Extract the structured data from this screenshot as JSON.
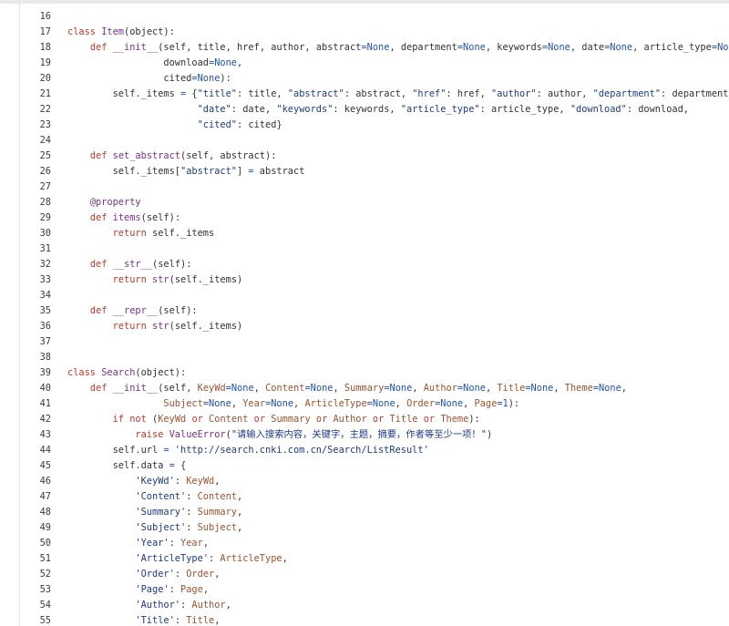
{
  "colors": {
    "keyword": "#c0392b",
    "function_name": "#7a2e8c",
    "constant": "#1f53b3",
    "string": "#1e3a8a",
    "argument": "#a0522d",
    "text": "#333333",
    "line_number": "#3a3a3a",
    "background": "#ffffff"
  },
  "code_lines": [
    {
      "num": "16",
      "tokens": []
    },
    {
      "num": "17",
      "tokens": [
        [
          "kw",
          "class"
        ],
        [
          "n",
          " "
        ],
        [
          "cls",
          "Item"
        ],
        [
          "n",
          "(object):"
        ]
      ]
    },
    {
      "num": "18",
      "tokens": [
        [
          "n",
          "    "
        ],
        [
          "kw",
          "def"
        ],
        [
          "n",
          " "
        ],
        [
          "fn",
          "__init__"
        ],
        [
          "n",
          "(self, title, href, author, abstract"
        ],
        [
          "op",
          "="
        ],
        [
          "con",
          "None"
        ],
        [
          "n",
          ", department"
        ],
        [
          "op",
          "="
        ],
        [
          "con",
          "None"
        ],
        [
          "n",
          ", keywords"
        ],
        [
          "op",
          "="
        ],
        [
          "con",
          "None"
        ],
        [
          "n",
          ", date"
        ],
        [
          "op",
          "="
        ],
        [
          "con",
          "None"
        ],
        [
          "n",
          ", article_type"
        ],
        [
          "op",
          "="
        ],
        [
          "con",
          "None"
        ],
        [
          "n",
          ","
        ]
      ]
    },
    {
      "num": "19",
      "tokens": [
        [
          "n",
          "                 download"
        ],
        [
          "op",
          "="
        ],
        [
          "con",
          "None"
        ],
        [
          "n",
          ","
        ]
      ]
    },
    {
      "num": "20",
      "tokens": [
        [
          "n",
          "                 cited"
        ],
        [
          "op",
          "="
        ],
        [
          "con",
          "None"
        ],
        [
          "n",
          "):"
        ]
      ]
    },
    {
      "num": "21",
      "tokens": [
        [
          "n",
          "        self._items "
        ],
        [
          "op",
          "="
        ],
        [
          "n",
          " {"
        ],
        [
          "str",
          "\"title\""
        ],
        [
          "n",
          ": title, "
        ],
        [
          "str",
          "\"abstract\""
        ],
        [
          "n",
          ": abstract, "
        ],
        [
          "str",
          "\"href\""
        ],
        [
          "n",
          ": href, "
        ],
        [
          "str",
          "\"author\""
        ],
        [
          "n",
          ": author, "
        ],
        [
          "str",
          "\"department\""
        ],
        [
          "n",
          ": department,"
        ]
      ]
    },
    {
      "num": "22",
      "tokens": [
        [
          "n",
          "                       "
        ],
        [
          "str",
          "\"date\""
        ],
        [
          "n",
          ": date, "
        ],
        [
          "str",
          "\"keywords\""
        ],
        [
          "n",
          ": keywords, "
        ],
        [
          "str",
          "\"article_type\""
        ],
        [
          "n",
          ": article_type, "
        ],
        [
          "str",
          "\"download\""
        ],
        [
          "n",
          ": download,"
        ]
      ]
    },
    {
      "num": "23",
      "tokens": [
        [
          "n",
          "                       "
        ],
        [
          "str",
          "\"cited\""
        ],
        [
          "n",
          ": cited}"
        ]
      ]
    },
    {
      "num": "24",
      "tokens": []
    },
    {
      "num": "25",
      "tokens": [
        [
          "n",
          "    "
        ],
        [
          "kw",
          "def"
        ],
        [
          "n",
          " "
        ],
        [
          "fn",
          "set_abstract"
        ],
        [
          "n",
          "(self, abstract):"
        ]
      ]
    },
    {
      "num": "26",
      "tokens": [
        [
          "n",
          "        self._items["
        ],
        [
          "str",
          "\"abstract\""
        ],
        [
          "n",
          "] "
        ],
        [
          "op",
          "="
        ],
        [
          "n",
          " abstract"
        ]
      ]
    },
    {
      "num": "27",
      "tokens": []
    },
    {
      "num": "28",
      "tokens": [
        [
          "n",
          "    "
        ],
        [
          "dec",
          "@property"
        ]
      ]
    },
    {
      "num": "29",
      "tokens": [
        [
          "n",
          "    "
        ],
        [
          "kw",
          "def"
        ],
        [
          "n",
          " "
        ],
        [
          "fn",
          "items"
        ],
        [
          "n",
          "(self):"
        ]
      ]
    },
    {
      "num": "30",
      "tokens": [
        [
          "n",
          "        "
        ],
        [
          "kw",
          "return"
        ],
        [
          "n",
          " self._items"
        ]
      ]
    },
    {
      "num": "31",
      "tokens": []
    },
    {
      "num": "32",
      "tokens": [
        [
          "n",
          "    "
        ],
        [
          "kw",
          "def"
        ],
        [
          "n",
          " "
        ],
        [
          "fn",
          "__str__"
        ],
        [
          "n",
          "(self):"
        ]
      ]
    },
    {
      "num": "33",
      "tokens": [
        [
          "n",
          "        "
        ],
        [
          "kw",
          "return"
        ],
        [
          "n",
          " "
        ],
        [
          "bi",
          "str"
        ],
        [
          "n",
          "(self._items)"
        ]
      ]
    },
    {
      "num": "34",
      "tokens": []
    },
    {
      "num": "35",
      "tokens": [
        [
          "n",
          "    "
        ],
        [
          "kw",
          "def"
        ],
        [
          "n",
          " "
        ],
        [
          "fn",
          "__repr__"
        ],
        [
          "n",
          "(self):"
        ]
      ]
    },
    {
      "num": "36",
      "tokens": [
        [
          "n",
          "        "
        ],
        [
          "kw",
          "return"
        ],
        [
          "n",
          " "
        ],
        [
          "bi",
          "str"
        ],
        [
          "n",
          "(self._items)"
        ]
      ]
    },
    {
      "num": "37",
      "tokens": []
    },
    {
      "num": "38",
      "tokens": []
    },
    {
      "num": "39",
      "tokens": [
        [
          "kw",
          "class"
        ],
        [
          "n",
          " "
        ],
        [
          "cls",
          "Search"
        ],
        [
          "n",
          "(object):"
        ]
      ]
    },
    {
      "num": "40",
      "tokens": [
        [
          "n",
          "    "
        ],
        [
          "kw",
          "def"
        ],
        [
          "n",
          " "
        ],
        [
          "fn",
          "__init__"
        ],
        [
          "n",
          "(self, "
        ],
        [
          "arg",
          "KeyWd"
        ],
        [
          "op",
          "="
        ],
        [
          "con",
          "None"
        ],
        [
          "n",
          ", "
        ],
        [
          "arg",
          "Content"
        ],
        [
          "op",
          "="
        ],
        [
          "con",
          "None"
        ],
        [
          "n",
          ", "
        ],
        [
          "arg",
          "Summary"
        ],
        [
          "op",
          "="
        ],
        [
          "con",
          "None"
        ],
        [
          "n",
          ", "
        ],
        [
          "arg",
          "Author"
        ],
        [
          "op",
          "="
        ],
        [
          "con",
          "None"
        ],
        [
          "n",
          ", "
        ],
        [
          "arg",
          "Title"
        ],
        [
          "op",
          "="
        ],
        [
          "con",
          "None"
        ],
        [
          "n",
          ", "
        ],
        [
          "arg",
          "Theme"
        ],
        [
          "op",
          "="
        ],
        [
          "con",
          "None"
        ],
        [
          "n",
          ","
        ]
      ]
    },
    {
      "num": "41",
      "tokens": [
        [
          "n",
          "                 "
        ],
        [
          "arg",
          "Subject"
        ],
        [
          "op",
          "="
        ],
        [
          "con",
          "None"
        ],
        [
          "n",
          ", "
        ],
        [
          "arg",
          "Year"
        ],
        [
          "op",
          "="
        ],
        [
          "con",
          "None"
        ],
        [
          "n",
          ", "
        ],
        [
          "arg",
          "ArticleType"
        ],
        [
          "op",
          "="
        ],
        [
          "con",
          "None"
        ],
        [
          "n",
          ", "
        ],
        [
          "arg",
          "Order"
        ],
        [
          "op",
          "="
        ],
        [
          "con",
          "None"
        ],
        [
          "n",
          ", "
        ],
        [
          "arg",
          "Page"
        ],
        [
          "op",
          "="
        ],
        [
          "num",
          "1"
        ],
        [
          "n",
          "):"
        ]
      ]
    },
    {
      "num": "42",
      "tokens": [
        [
          "n",
          "        "
        ],
        [
          "kw",
          "if"
        ],
        [
          "n",
          " "
        ],
        [
          "kw",
          "not"
        ],
        [
          "n",
          " ("
        ],
        [
          "arg",
          "KeyWd"
        ],
        [
          "n",
          " "
        ],
        [
          "kw",
          "or"
        ],
        [
          "n",
          " "
        ],
        [
          "arg",
          "Content"
        ],
        [
          "n",
          " "
        ],
        [
          "kw",
          "or"
        ],
        [
          "n",
          " "
        ],
        [
          "arg",
          "Summary"
        ],
        [
          "n",
          " "
        ],
        [
          "kw",
          "or"
        ],
        [
          "n",
          " "
        ],
        [
          "arg",
          "Author"
        ],
        [
          "n",
          " "
        ],
        [
          "kw",
          "or"
        ],
        [
          "n",
          " "
        ],
        [
          "arg",
          "Title"
        ],
        [
          "n",
          " "
        ],
        [
          "kw",
          "or"
        ],
        [
          "n",
          " "
        ],
        [
          "arg",
          "Theme"
        ],
        [
          "n",
          "):"
        ]
      ]
    },
    {
      "num": "43",
      "tokens": [
        [
          "n",
          "            "
        ],
        [
          "kw",
          "raise"
        ],
        [
          "n",
          " "
        ],
        [
          "bi",
          "ValueError"
        ],
        [
          "n",
          "("
        ],
        [
          "str",
          "\"请输入搜索内容，关键字，主题，摘要，作者等至少一项！\""
        ],
        [
          "n",
          ")"
        ]
      ]
    },
    {
      "num": "44",
      "tokens": [
        [
          "n",
          "        self.url "
        ],
        [
          "op",
          "="
        ],
        [
          "n",
          " "
        ],
        [
          "str",
          "'http://search.cnki.com.cn/Search/ListResult'"
        ]
      ]
    },
    {
      "num": "45",
      "tokens": [
        [
          "n",
          "        self.data "
        ],
        [
          "op",
          "="
        ],
        [
          "n",
          " {"
        ]
      ]
    },
    {
      "num": "46",
      "tokens": [
        [
          "n",
          "            "
        ],
        [
          "str",
          "'KeyWd'"
        ],
        [
          "n",
          ": "
        ],
        [
          "arg",
          "KeyWd"
        ],
        [
          "n",
          ","
        ]
      ]
    },
    {
      "num": "47",
      "tokens": [
        [
          "n",
          "            "
        ],
        [
          "str",
          "'Content'"
        ],
        [
          "n",
          ": "
        ],
        [
          "arg",
          "Content"
        ],
        [
          "n",
          ","
        ]
      ]
    },
    {
      "num": "48",
      "tokens": [
        [
          "n",
          "            "
        ],
        [
          "str",
          "'Summary'"
        ],
        [
          "n",
          ": "
        ],
        [
          "arg",
          "Summary"
        ],
        [
          "n",
          ","
        ]
      ]
    },
    {
      "num": "49",
      "tokens": [
        [
          "n",
          "            "
        ],
        [
          "str",
          "'Subject'"
        ],
        [
          "n",
          ": "
        ],
        [
          "arg",
          "Subject"
        ],
        [
          "n",
          ","
        ]
      ]
    },
    {
      "num": "50",
      "tokens": [
        [
          "n",
          "            "
        ],
        [
          "str",
          "'Year'"
        ],
        [
          "n",
          ": "
        ],
        [
          "arg",
          "Year"
        ],
        [
          "n",
          ","
        ]
      ]
    },
    {
      "num": "51",
      "tokens": [
        [
          "n",
          "            "
        ],
        [
          "str",
          "'ArticleType'"
        ],
        [
          "n",
          ": "
        ],
        [
          "arg",
          "ArticleType"
        ],
        [
          "n",
          ","
        ]
      ]
    },
    {
      "num": "52",
      "tokens": [
        [
          "n",
          "            "
        ],
        [
          "str",
          "'Order'"
        ],
        [
          "n",
          ": "
        ],
        [
          "arg",
          "Order"
        ],
        [
          "n",
          ","
        ]
      ]
    },
    {
      "num": "53",
      "tokens": [
        [
          "n",
          "            "
        ],
        [
          "str",
          "'Page'"
        ],
        [
          "n",
          ": "
        ],
        [
          "arg",
          "Page"
        ],
        [
          "n",
          ","
        ]
      ]
    },
    {
      "num": "54",
      "tokens": [
        [
          "n",
          "            "
        ],
        [
          "str",
          "'Author'"
        ],
        [
          "n",
          ": "
        ],
        [
          "arg",
          "Author"
        ],
        [
          "n",
          ","
        ]
      ]
    },
    {
      "num": "55",
      "tokens": [
        [
          "n",
          "            "
        ],
        [
          "str",
          "'Title'"
        ],
        [
          "n",
          ": "
        ],
        [
          "arg",
          "Title"
        ],
        [
          "n",
          ","
        ]
      ]
    }
  ]
}
